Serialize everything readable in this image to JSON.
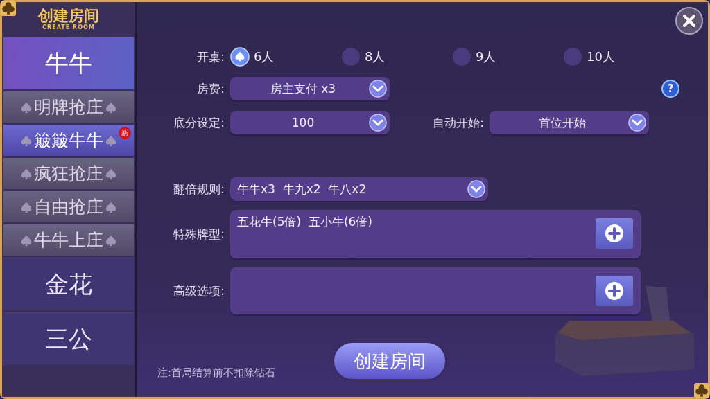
{
  "logo": {
    "title": "创建房间",
    "subtitle": "CREATE ROOM"
  },
  "sidebar": {
    "items": [
      {
        "label": "牛牛",
        "selected": true,
        "children": [
          {
            "label": "明牌抢庄",
            "selected": false
          },
          {
            "label": "簸簸牛牛",
            "selected": true,
            "badge": "新"
          },
          {
            "label": "疯狂抢庄",
            "selected": false
          },
          {
            "label": "自由抢庄",
            "selected": false
          },
          {
            "label": "牛牛上庄",
            "selected": false
          }
        ]
      },
      {
        "label": "金花",
        "selected": false
      },
      {
        "label": "三公",
        "selected": false
      }
    ]
  },
  "form": {
    "rows": [
      {
        "kind": "radio",
        "label": "开桌:",
        "options": [
          {
            "label": "6人",
            "selected": true
          },
          {
            "label": "8人",
            "selected": false
          },
          {
            "label": "9人",
            "selected": false
          },
          {
            "label": "10人",
            "selected": false
          }
        ]
      },
      {
        "kind": "select",
        "label": "房费:",
        "value": "房主支付 x3",
        "help": "?"
      },
      {
        "kind": "pair",
        "fields": [
          {
            "label": "底分设定:",
            "value": "100"
          },
          {
            "label": "自动开始:",
            "value": "首位开始"
          }
        ]
      },
      {
        "kind": "wide",
        "label": "翻倍规则:",
        "value": "牛牛x3  牛九x2  牛八x2"
      },
      {
        "kind": "box",
        "label": "特殊牌型:",
        "value": "五花牛(5倍)  五小牛(6倍)"
      },
      {
        "kind": "box",
        "label": "高级选项:",
        "value": ""
      }
    ]
  },
  "note": "注:首局结算前不扣除钻石",
  "create_button": "创建房间"
}
